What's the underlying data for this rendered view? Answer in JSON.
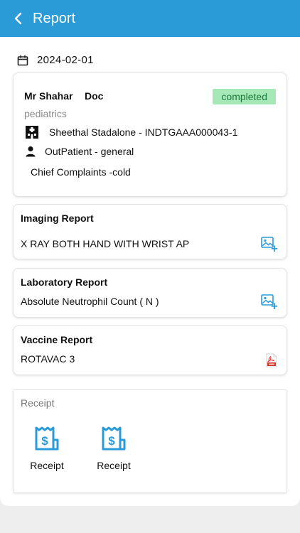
{
  "header": {
    "title": "Report"
  },
  "date": "2024-02-01",
  "visit": {
    "patient_name": "Mr Shahar",
    "doctor_label": "Doc",
    "status": "completed",
    "department": "pediatrics",
    "hospital": "Sheethal Stadalone - INDTGAAA000043-1",
    "patient_type": "OutPatient - general",
    "chief_complaints": "Chief Complaints -cold"
  },
  "reports": {
    "imaging": {
      "title": "Imaging Report",
      "item": "X RAY BOTH HAND WITH WRIST AP",
      "icon": "add-image-icon"
    },
    "laboratory": {
      "title": "Laboratory Report",
      "item": "Absolute Neutrophil Count ( N )",
      "icon": "add-image-icon"
    },
    "vaccine": {
      "title": "Vaccine Report",
      "item": "ROTAVAC 3",
      "icon": "pdf-icon"
    }
  },
  "receipts": {
    "heading": "Receipt",
    "items": [
      {
        "label": "Receipt"
      },
      {
        "label": "Receipt"
      }
    ]
  },
  "colors": {
    "appbar": "#2b9bd8",
    "badge_bg": "#a6e8b8",
    "badge_text": "#1a7a3a",
    "icon_blue": "#2b9bd8",
    "pdf_red": "#d9342b"
  }
}
